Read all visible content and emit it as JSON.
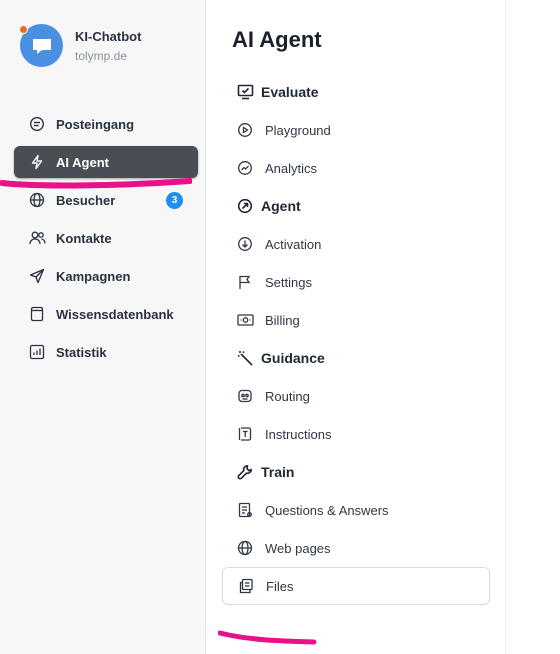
{
  "account": {
    "name": "KI-Chatbot",
    "domain": "tolymp.de"
  },
  "sidebar": {
    "items": [
      {
        "label": "Posteingang",
        "icon": "chat-bubble-icon"
      },
      {
        "label": "AI Agent",
        "icon": "lightning-icon",
        "active": true
      },
      {
        "label": "Besucher",
        "icon": "globe-icon",
        "badge": "3"
      },
      {
        "label": "Kontakte",
        "icon": "users-icon"
      },
      {
        "label": "Kampagnen",
        "icon": "send-icon"
      },
      {
        "label": "Wissensdatenbank",
        "icon": "book-icon"
      },
      {
        "label": "Statistik",
        "icon": "bar-chart-icon"
      }
    ]
  },
  "main": {
    "title": "AI Agent",
    "sections": [
      {
        "label": "Evaluate",
        "icon": "monitor-check-icon",
        "items": [
          {
            "label": "Playground",
            "icon": "play-circle-icon"
          },
          {
            "label": "Analytics",
            "icon": "trend-icon"
          }
        ]
      },
      {
        "label": "Agent",
        "icon": "arrow-circle-icon",
        "items": [
          {
            "label": "Activation",
            "icon": "download-circle-icon"
          },
          {
            "label": "Settings",
            "icon": "flag-icon"
          },
          {
            "label": "Billing",
            "icon": "banknote-icon"
          }
        ]
      },
      {
        "label": "Guidance",
        "icon": "magic-wand-icon",
        "items": [
          {
            "label": "Routing",
            "icon": "robot-icon"
          },
          {
            "label": "Instructions",
            "icon": "text-box-icon"
          }
        ]
      },
      {
        "label": "Train",
        "icon": "wrench-icon",
        "items": [
          {
            "label": "Questions & Answers",
            "icon": "document-list-icon"
          },
          {
            "label": "Web pages",
            "icon": "globe-icon"
          },
          {
            "label": "Files",
            "icon": "file-copy-icon",
            "selected": true
          }
        ]
      }
    ]
  },
  "colors": {
    "active_nav": "#4a4e54",
    "badge": "#1f8ef1",
    "highlight": "#e8118a",
    "logo": "#4a90e2",
    "logo_dot": "#f26b1d"
  }
}
